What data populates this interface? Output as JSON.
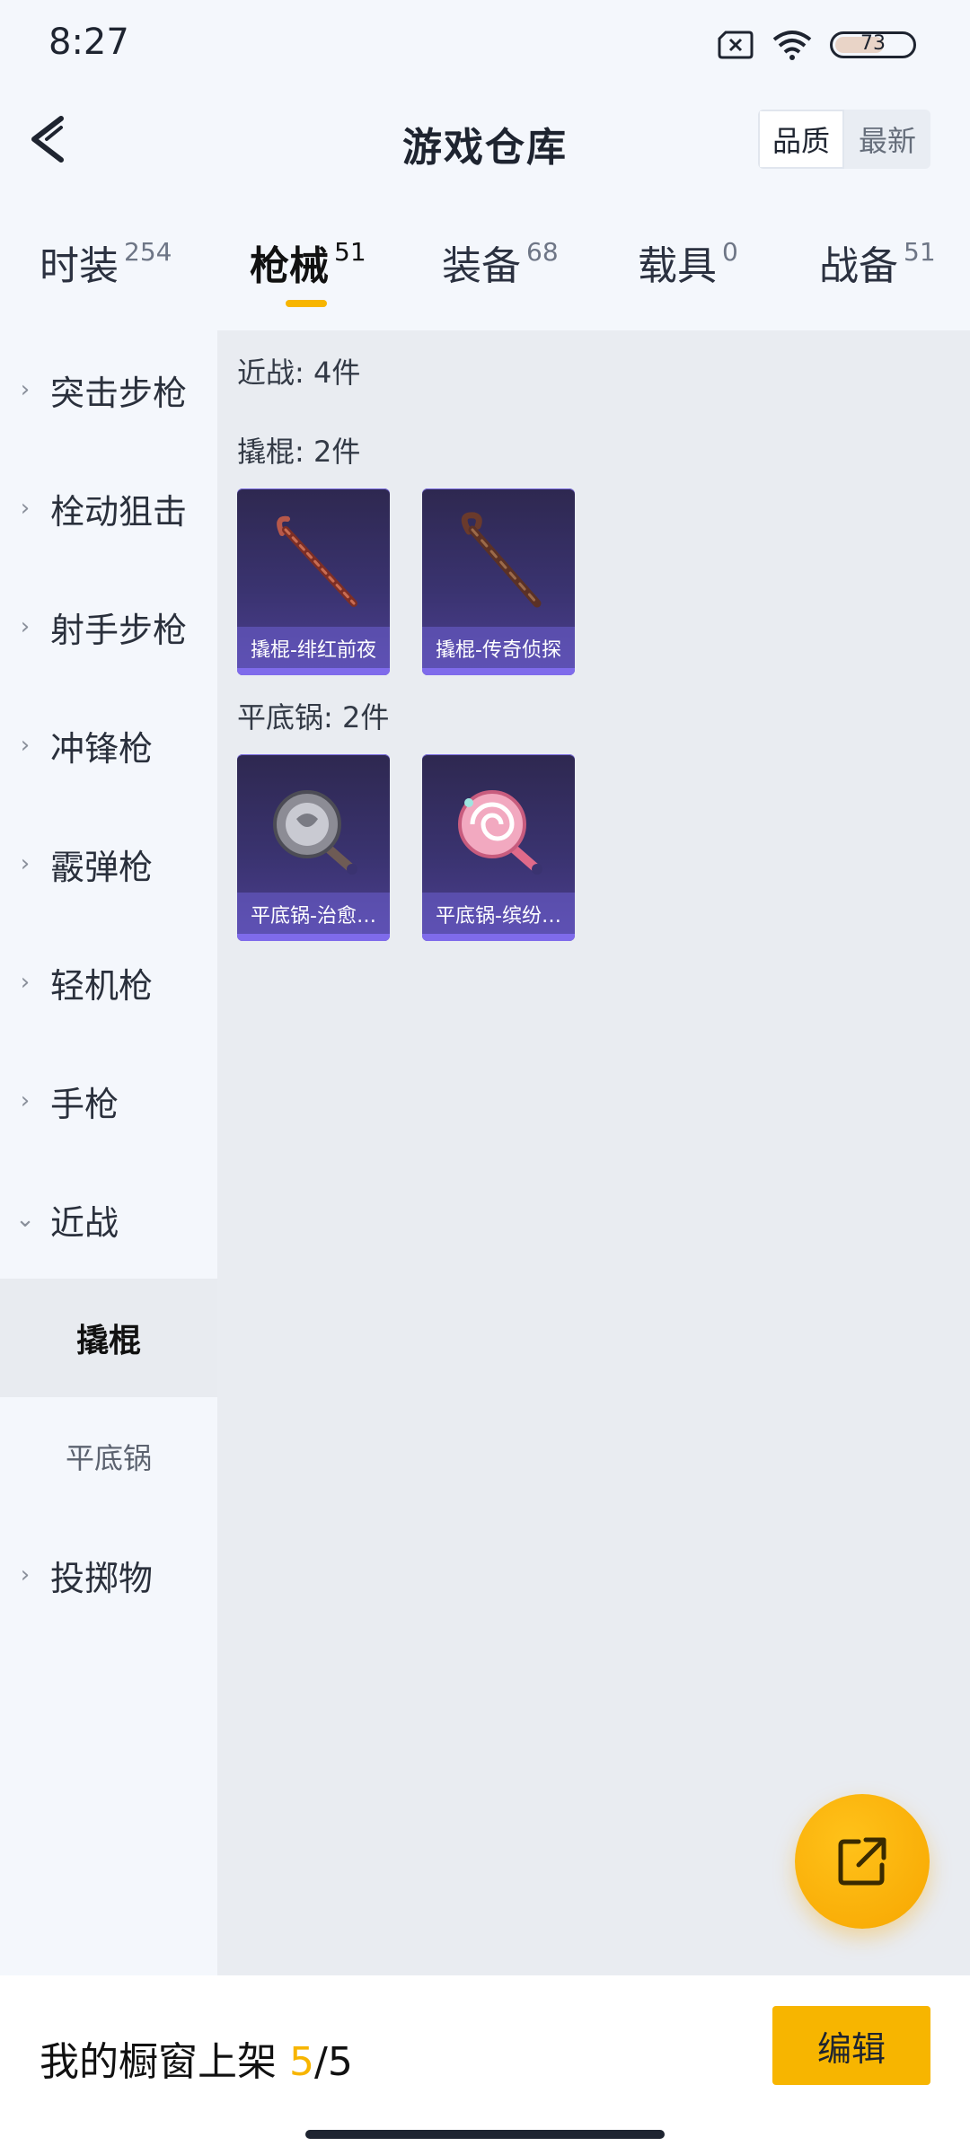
{
  "status": {
    "time": "8:27",
    "battery": "73"
  },
  "header": {
    "title": "游戏仓库",
    "sort_quality": "品质",
    "sort_latest": "最新"
  },
  "tabs": [
    {
      "label": "时装",
      "count": "254"
    },
    {
      "label": "枪械",
      "count": "51"
    },
    {
      "label": "装备",
      "count": "68"
    },
    {
      "label": "载具",
      "count": "0"
    },
    {
      "label": "战备",
      "count": "51"
    }
  ],
  "sidebar": {
    "items": [
      {
        "label": "突击步枪"
      },
      {
        "label": "栓动狙击"
      },
      {
        "label": "射手步枪"
      },
      {
        "label": "冲锋枪"
      },
      {
        "label": "霰弹枪"
      },
      {
        "label": "轻机枪"
      },
      {
        "label": "手枪"
      },
      {
        "label": "近战"
      },
      {
        "label": "投掷物"
      }
    ],
    "sub_items": [
      {
        "label": "撬棍"
      },
      {
        "label": "平底锅"
      }
    ]
  },
  "content": {
    "melee_summary": "近战: 4件",
    "crowbar_summary": "撬棍: 2件",
    "pan_summary": "平底锅: 2件",
    "crowbar_items": [
      {
        "name": "撬棍-绯红前夜"
      },
      {
        "name": "撬棍-传奇侦探"
      }
    ],
    "pan_items": [
      {
        "name": "平底锅-治愈…"
      },
      {
        "name": "平底锅-缤纷…"
      }
    ]
  },
  "bottom": {
    "showcase_label": "我的橱窗上架",
    "showcase_current": "5",
    "showcase_total": "/5",
    "edit": "编辑"
  },
  "colors": {
    "accent": "#F7B500",
    "card": "#3A3370"
  }
}
